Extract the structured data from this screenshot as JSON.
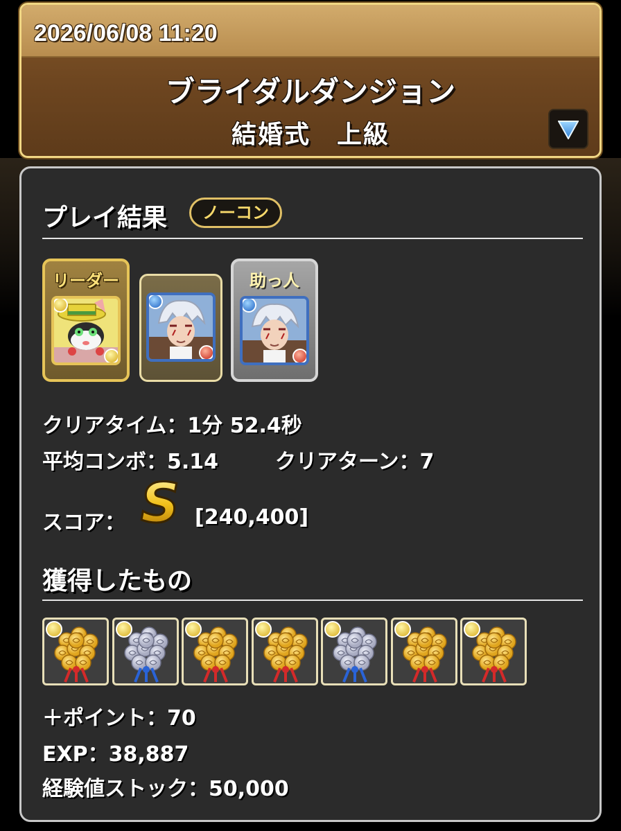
{
  "header": {
    "datetime": "2026/06/08 11:20",
    "dungeon_name": "ブライダルダンジョン",
    "floor_name": "結婚式　上級"
  },
  "result": {
    "title": "プレイ結果",
    "badge": "ノーコン"
  },
  "team": {
    "leader_label": "リーダー",
    "helper_label": "助っ人",
    "members": [
      {
        "slot": "leader",
        "icon": "bride-cat-monster-icon",
        "attributes": [
          "light",
          "light"
        ]
      },
      {
        "slot": "sub",
        "icon": "gintoki-monster-icon",
        "attributes": [
          "water",
          "fire"
        ]
      },
      {
        "slot": "helper",
        "icon": "gintoki-monster-icon",
        "attributes": [
          "water",
          "fire"
        ]
      }
    ]
  },
  "stats": {
    "clear_time": "クリアタイム：1分 52.4秒",
    "avg_combo": "平均コンボ：5.14",
    "clear_turns": "クリアターン：7",
    "score_label": "スコア：",
    "score_rank": "S",
    "score_value": "[240,400]"
  },
  "rewards": {
    "title": "獲得したもの",
    "items": [
      {
        "icon": "gold-rose-bouquet-icon",
        "type": "gold"
      },
      {
        "icon": "silver-rose-bouquet-icon",
        "type": "silver"
      },
      {
        "icon": "gold-rose-bouquet-icon",
        "type": "gold"
      },
      {
        "icon": "gold-rose-bouquet-icon",
        "type": "gold"
      },
      {
        "icon": "silver-rose-bouquet-icon",
        "type": "silver"
      },
      {
        "icon": "gold-rose-bouquet-icon",
        "type": "gold"
      },
      {
        "icon": "gold-rose-bouquet-icon",
        "type": "gold"
      }
    ],
    "points": "＋ポイント：70",
    "exp": "EXP：38,887",
    "exp_stock": "経験値ストック：50,000"
  },
  "colors": {
    "header_border": "#f1d784",
    "panel_bg": "#2b2b2b",
    "badge_text": "#f7d96b",
    "gold": "#e7b62a",
    "silver": "#b9bccf"
  }
}
